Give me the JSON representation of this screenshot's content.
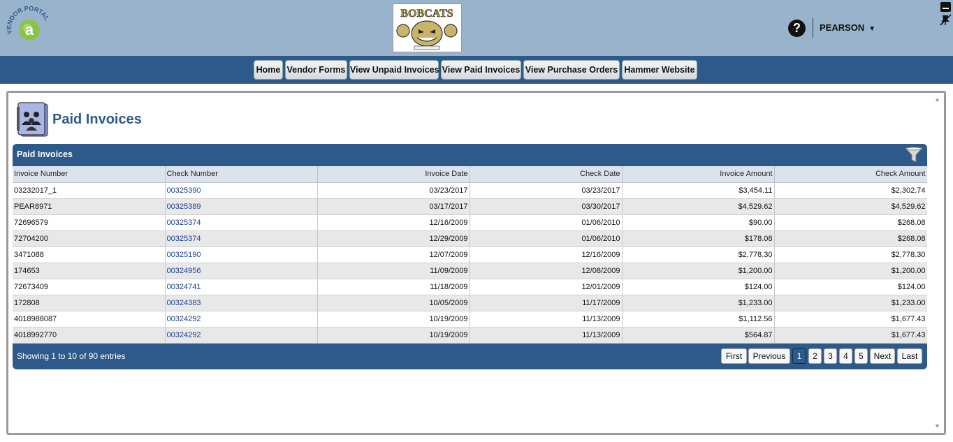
{
  "header": {
    "logo_text": "VENDOR PORTAL",
    "logo_letter": "a",
    "mascot_text": "BOBCATS",
    "help_label": "?",
    "user_name": "PEARSON"
  },
  "nav": {
    "home": "Home",
    "vendor_forms": "Vendor Forms",
    "view_unpaid": "View Unpaid Invoices",
    "view_paid": "View Paid Invoices",
    "view_po": "View Purchase Orders",
    "hammer": "Hammer Website"
  },
  "page": {
    "title": "Paid Invoices"
  },
  "table": {
    "caption": "Paid Invoices",
    "columns": [
      "Invoice Number",
      "Check Number",
      "Invoice Date",
      "Check Date",
      "Invoice Amount",
      "Check Amount"
    ],
    "rows": [
      [
        "03232017_1",
        "00325390",
        "03/23/2017",
        "03/23/2017",
        "$3,454.11",
        "$2,302.74"
      ],
      [
        "PEAR8971",
        "00325389",
        "03/17/2017",
        "03/30/2017",
        "$4,529.62",
        "$4,529.62"
      ],
      [
        "72696579",
        "00325374",
        "12/16/2009",
        "01/06/2010",
        "$90.00",
        "$268.08"
      ],
      [
        "72704200",
        "00325374",
        "12/29/2009",
        "01/06/2010",
        "$178.08",
        "$268.08"
      ],
      [
        "3471088",
        "00325190",
        "12/07/2009",
        "12/16/2009",
        "$2,778.30",
        "$2,778.30"
      ],
      [
        "174653",
        "00324956",
        "11/09/2009",
        "12/08/2009",
        "$1,200.00",
        "$1,200.00"
      ],
      [
        "72673409",
        "00324741",
        "11/18/2009",
        "12/01/2009",
        "$124.00",
        "$124.00"
      ],
      [
        "172808",
        "00324383",
        "10/05/2009",
        "11/17/2009",
        "$1,233.00",
        "$1,233.00"
      ],
      [
        "4018988087",
        "00324292",
        "10/19/2009",
        "11/13/2009",
        "$1,112.56",
        "$1,677.43"
      ],
      [
        "4018992770",
        "00324292",
        "10/19/2009",
        "11/13/2009",
        "$564.87",
        "$1,677.43"
      ]
    ],
    "entries_info": "Showing 1 to 10 of 90 entries"
  },
  "pagination": {
    "first": "First",
    "previous": "Previous",
    "p1": "1",
    "p2": "2",
    "p3": "3",
    "p4": "4",
    "p5": "5",
    "next": "Next",
    "last": "Last"
  },
  "colors": {
    "header_bg": "#9ab3cc",
    "nav_bg": "#2d5a8a",
    "title_color": "#2d5a8a",
    "logo_green": "#8bc34a"
  }
}
